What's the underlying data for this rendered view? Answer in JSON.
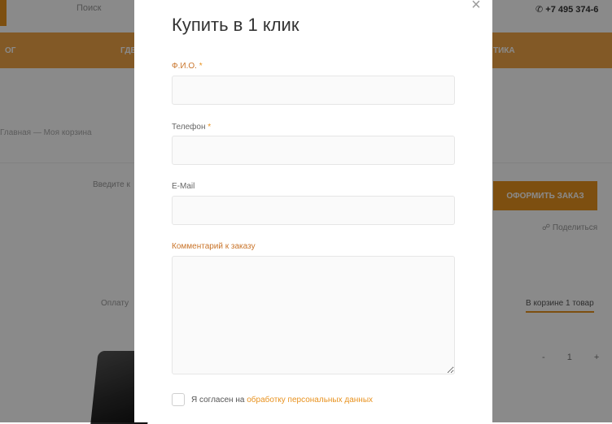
{
  "background": {
    "search_placeholder": "Поиск",
    "phone": "+7 495 374-6",
    "nav_items": [
      "ог",
      "ГДЕ",
      "тика"
    ],
    "breadcrumbs": "Главная — Моя корзина",
    "coupon_hint": "Введите к",
    "order_button": "Оформить заказ",
    "share_label": "Поделиться",
    "buy_text": "Оплату",
    "cart_link": "В корзине 1 товар",
    "qty": "- 1 +",
    "accent_color": "#e8921f"
  },
  "modal": {
    "title": "Купить в 1 клик",
    "close_icon": "close-icon",
    "fields": {
      "fio": {
        "label": "Ф.И.О.",
        "required_mark": "*",
        "value": "",
        "placeholder": ""
      },
      "phone": {
        "label": "Телефон",
        "required_mark": "*",
        "value": "",
        "placeholder": ""
      },
      "email": {
        "label": "E-Mail",
        "value": "",
        "placeholder": ""
      },
      "comment": {
        "label": "Комментарий к заказу",
        "value": "",
        "placeholder": ""
      }
    },
    "consent": {
      "text": "Я согласен на ",
      "link_text": "обработку персональных данных",
      "checked": false
    }
  }
}
